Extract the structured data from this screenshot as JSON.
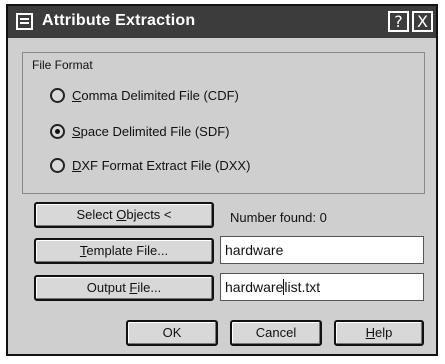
{
  "dialog": {
    "title": "Attribute Extraction",
    "help_button": "?",
    "close_button": "X"
  },
  "file_format": {
    "legend": "File Format",
    "options": [
      {
        "prefix": "",
        "accel": "C",
        "rest": "omma Delimited File (CDF)",
        "checked": false
      },
      {
        "prefix": "",
        "accel": "S",
        "rest": "pace Delimited File (SDF)",
        "checked": true
      },
      {
        "prefix": "",
        "accel": "D",
        "rest": "XF Format Extract File (DXX)",
        "checked": false
      }
    ]
  },
  "select_objects": {
    "pre": "Select ",
    "accel": "O",
    "post": "bjects <"
  },
  "number_found": {
    "label": "Number found:",
    "value": "0"
  },
  "template": {
    "pre": "",
    "accel": "T",
    "post": "emplate File...",
    "value": "hardware"
  },
  "output": {
    "pre": "Output ",
    "accel": "F",
    "post": "ile...",
    "value_before_caret": "hardware",
    "value_after_caret": "list.txt"
  },
  "buttons": {
    "ok": "OK",
    "cancel": "Cancel",
    "help_accel": "H",
    "help_rest": "elp"
  }
}
